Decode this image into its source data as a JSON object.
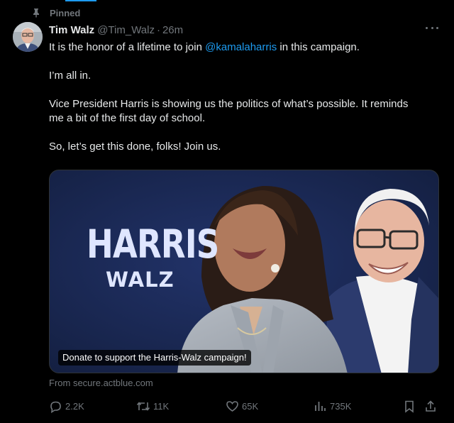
{
  "pinned_label": "Pinned",
  "author": {
    "name": "Tim Walz",
    "handle": "@Tim_Walz",
    "separator": "·",
    "time": "26m"
  },
  "post": {
    "line1_before": "It is the honor of a lifetime to join ",
    "mention": "@kamalaharris",
    "line1_after": " in this campaign.",
    "para2": "I’m all in.",
    "para3": "Vice President Harris is showing us the politics of what’s possible. It reminds me a bit of the first day of school.",
    "para4": "So, let’s get this done, folks! Join us."
  },
  "card": {
    "brand_line1": "HARRIS",
    "brand_line2": "WALZ",
    "caption": "Donate to support the Harris-Walz campaign!",
    "source": "From secure.actblue.com"
  },
  "metrics": {
    "replies": "2.2K",
    "reposts": "11K",
    "likes": "65K",
    "views": "735K"
  },
  "icons": {
    "pin": "pin-icon",
    "more": "more-icon",
    "reply": "reply-icon",
    "repost": "repost-icon",
    "like": "heart-icon",
    "views": "views-icon",
    "bookmark": "bookmark-icon",
    "share": "share-icon"
  },
  "colors": {
    "accent": "#1d9bf0",
    "muted": "#71767b",
    "text": "#e7e9ea",
    "card_bg": "#172448"
  }
}
